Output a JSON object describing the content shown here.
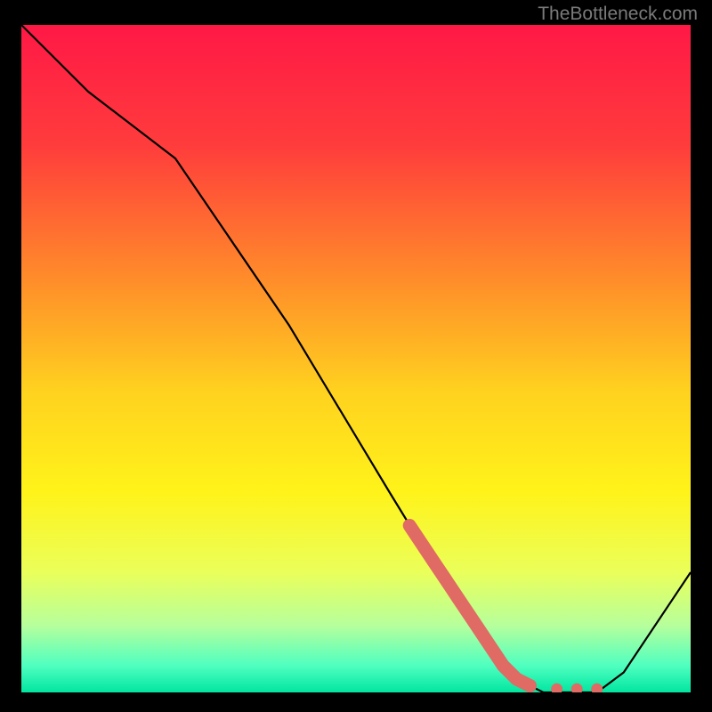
{
  "attribution": "TheBottleneck.com",
  "chart_data": {
    "type": "line",
    "title": "",
    "xlabel": "",
    "ylabel": "",
    "xlim": [
      0,
      100
    ],
    "ylim": [
      0,
      100
    ],
    "grid": false,
    "series": [
      {
        "name": "bottleneck-curve",
        "x": [
          0,
          10,
          23,
          40,
          55,
          66,
          74,
          78,
          82,
          86,
          90,
          100
        ],
        "values": [
          100,
          90,
          80,
          55,
          30,
          12,
          2,
          0,
          0,
          0,
          3,
          18
        ]
      }
    ],
    "markers": {
      "name": "highlight-dots",
      "color": "#e06a64",
      "points": [
        {
          "x": 58,
          "y": 25
        },
        {
          "x": 60,
          "y": 22
        },
        {
          "x": 62,
          "y": 19
        },
        {
          "x": 64,
          "y": 16
        },
        {
          "x": 66,
          "y": 13
        },
        {
          "x": 68,
          "y": 10
        },
        {
          "x": 70,
          "y": 7
        },
        {
          "x": 72,
          "y": 4
        },
        {
          "x": 74,
          "y": 2
        },
        {
          "x": 76,
          "y": 1
        },
        {
          "x": 80,
          "y": 0.5
        },
        {
          "x": 83,
          "y": 0.5
        },
        {
          "x": 86,
          "y": 0.5
        }
      ]
    },
    "background_gradient": {
      "stops": [
        {
          "offset": 0.0,
          "color": "#ff1846"
        },
        {
          "offset": 0.18,
          "color": "#ff3c3c"
        },
        {
          "offset": 0.38,
          "color": "#ff8c2a"
        },
        {
          "offset": 0.55,
          "color": "#ffd21f"
        },
        {
          "offset": 0.7,
          "color": "#fff31a"
        },
        {
          "offset": 0.82,
          "color": "#eaff5a"
        },
        {
          "offset": 0.9,
          "color": "#b6ff9c"
        },
        {
          "offset": 0.96,
          "color": "#4fffc0"
        },
        {
          "offset": 1.0,
          "color": "#00e6a0"
        }
      ]
    }
  }
}
